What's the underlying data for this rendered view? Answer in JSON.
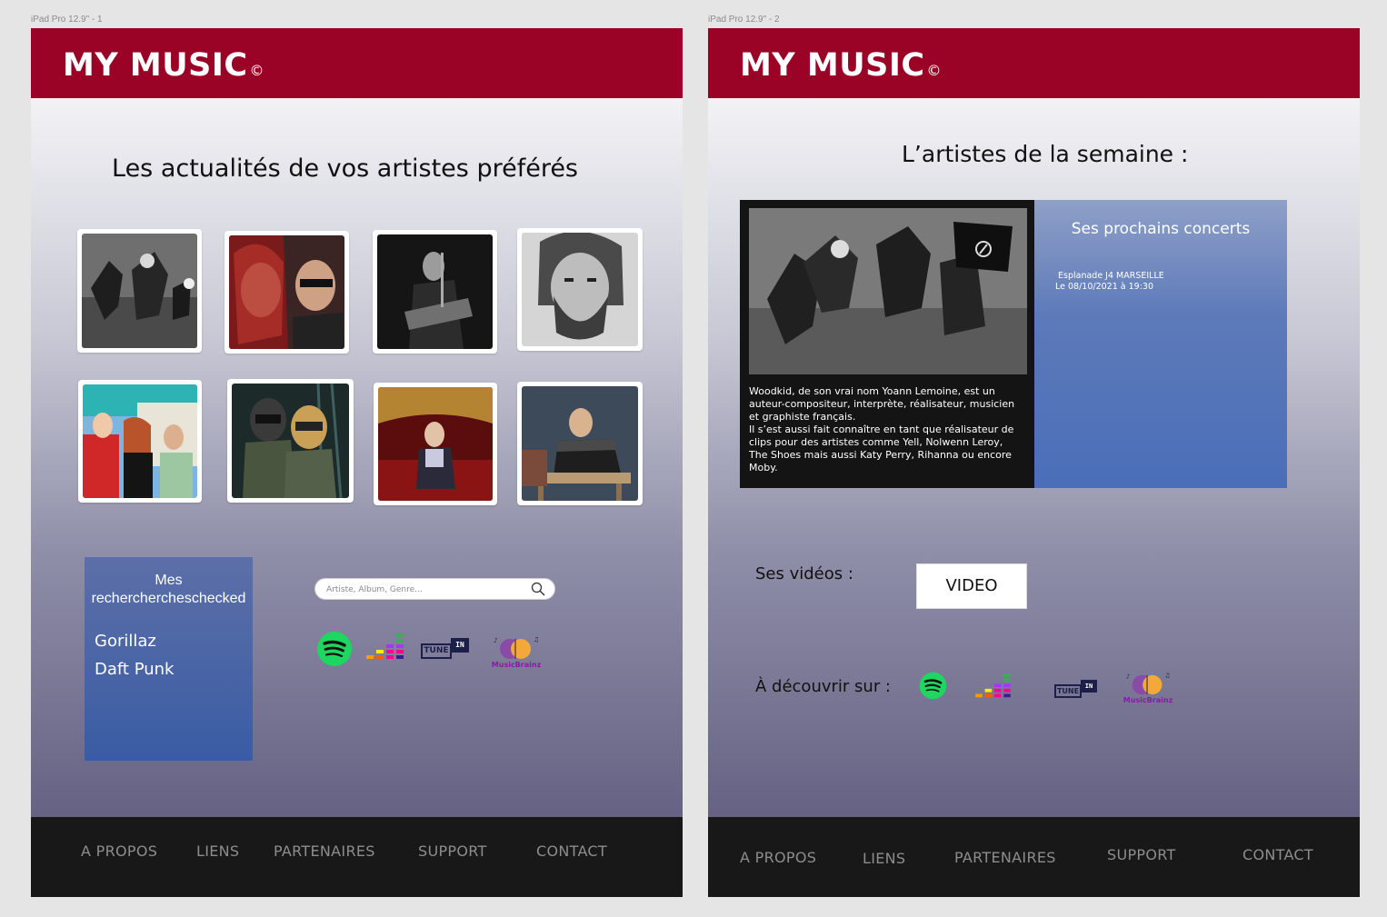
{
  "artboards": [
    {
      "label": "iPad Pro 12.9\" - 1"
    },
    {
      "label": "iPad Pro 12.9\" - 2"
    }
  ],
  "brand": {
    "name": "MY MUSIC",
    "symbol": "©",
    "header_color": "#9a0326"
  },
  "page1": {
    "title": "Les actualités de vos artistes préférés",
    "photos": [
      "woodkid-photo",
      "band-photo",
      "guitarist-photo",
      "bearded-man-photo",
      "trio-photo",
      "daft-punk-photo",
      "theatre-man-photo",
      "piano-man-photo"
    ],
    "recent": {
      "heading": "Mes recherchercheschecked",
      "heading_line1": "Mes recherchercheschecked",
      "items": [
        "Gorillaz",
        "Daft Punk"
      ]
    },
    "search": {
      "placeholder": "Artiste, Album, Genre..."
    },
    "services": [
      "spotify-icon",
      "deezer-icon",
      "tunein-icon",
      "musicbrainz-icon"
    ]
  },
  "page2": {
    "title": "L’artistes de la semaine :",
    "description": "Woodkid, de son vrai nom Yoann Lemoine, est un auteur-compositeur, interprète, réalisateur, musicien et graphiste français.\nIl s’est aussi fait connaître en tant que réalisateur de clips pour des artistes comme Yell, Nolwenn Leroy, The Shoes mais aussi Katy Perry, Rihanna ou encore Moby.",
    "concerts": {
      "heading": "Ses prochains concerts",
      "venue": "Esplanade J4 MARSEILLE",
      "date": "Le 08/10/2021 à 19:30"
    },
    "videos_label": "Ses vidéos :",
    "video_button": "VIDEO",
    "discover_label": "À découvrir sur :"
  },
  "services": {
    "tunein": "TUNE",
    "tunein_badge": "IN",
    "musicbrainz": "MusicBrainz"
  },
  "footer": {
    "about": "A PROPOS",
    "links": "LIENS",
    "partners": "PARTENAIRES",
    "support": "SUPPORT",
    "contact": "CONTACT"
  }
}
